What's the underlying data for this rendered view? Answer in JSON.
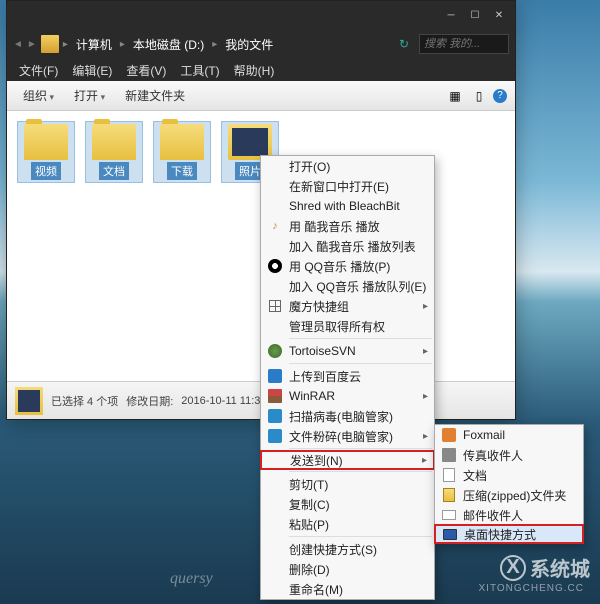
{
  "window": {
    "breadcrumb": [
      "计算机",
      "本地磁盘 (D:)",
      "我的文件"
    ],
    "search_placeholder": "搜索 我的..."
  },
  "menubar": {
    "file": "文件(F)",
    "edit": "编辑(E)",
    "view": "查看(V)",
    "tools": "工具(T)",
    "help": "帮助(H)"
  },
  "toolbar": {
    "organize": "组织",
    "open": "打开",
    "new_folder": "新建文件夹"
  },
  "folders": [
    {
      "label": "视频"
    },
    {
      "label": "文档"
    },
    {
      "label": "下载"
    },
    {
      "label": "照片"
    }
  ],
  "statusbar": {
    "selection": "已选择 4 个项",
    "modified_label": "修改日期:",
    "modified_value": "2016-10-11 11:3"
  },
  "context_menu": {
    "open": "打开(O)",
    "open_new_window": "在新窗口中打开(E)",
    "shred": "Shred with BleachBit",
    "kuwo_play": "用 酷我音乐 播放",
    "kuwo_add": "加入 酷我音乐 播放列表",
    "qq_play": "用 QQ音乐 播放(P)",
    "qq_add": "加入 QQ音乐 播放队列(E)",
    "magic": "魔方快捷组",
    "admin_own": "管理员取得所有权",
    "tortoise": "TortoiseSVN",
    "upload_baidu": "上传到百度云",
    "winrar": "WinRAR",
    "scan_virus": "扫描病毒(电脑管家)",
    "file_shred": "文件粉碎(电脑管家)",
    "send_to": "发送到(N)",
    "cut": "剪切(T)",
    "copy": "复制(C)",
    "paste": "粘贴(P)",
    "create_shortcut": "创建快捷方式(S)",
    "delete": "删除(D)",
    "rename": "重命名(M)"
  },
  "submenu": {
    "foxmail": "Foxmail",
    "fax": "传真收件人",
    "doc": "文档",
    "zip": "压缩(zipped)文件夹",
    "mail": "邮件收件人",
    "desktop_shortcut": "桌面快捷方式"
  },
  "watermark": {
    "brand": "系统城",
    "sub": "XITONGCHENG.CC",
    "cursive": "quersy"
  }
}
